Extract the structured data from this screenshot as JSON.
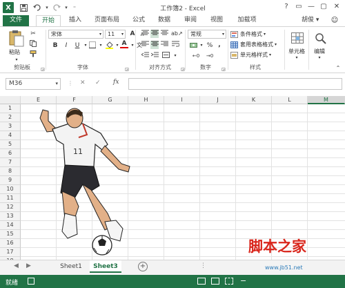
{
  "title": {
    "app_logo": "X",
    "window_title": "工作簿2 - Excel",
    "window_buttons": [
      "?",
      "▭",
      "—",
      "▢",
      "✕"
    ]
  },
  "tabs": {
    "items": [
      "文件",
      "开始",
      "插入",
      "页面布局",
      "公式",
      "数据",
      "审阅",
      "视图",
      "加载项"
    ],
    "active": "开始",
    "user": "胡俊 ▾"
  },
  "ribbon": {
    "clipboard": {
      "paste": "粘贴",
      "label": "剪贴板"
    },
    "font": {
      "name": "宋体",
      "size": "11",
      "bold": "B",
      "italic": "I",
      "underline": "U",
      "font_color": "A",
      "grow": "A",
      "shrink": "A",
      "label": "字体"
    },
    "alignment": {
      "label": "对齐方式"
    },
    "number": {
      "format": "常规",
      "percent": "%",
      "comma": ",",
      "label": "数字"
    },
    "styles": {
      "conditional": "条件格式",
      "table": "套用表格格式",
      "cell": "单元格样式",
      "label": "样式"
    },
    "cells": {
      "label": "单元格"
    },
    "editing": {
      "label": "编辑"
    }
  },
  "formula_bar": {
    "name_box": "M36",
    "cancel": "✕",
    "enter": "✓",
    "fx": "fx"
  },
  "grid": {
    "columns": [
      "E",
      "F",
      "G",
      "H",
      "I",
      "J",
      "K",
      "L",
      "M"
    ],
    "rows": [
      "1",
      "2",
      "3",
      "4",
      "5",
      "6",
      "7",
      "8",
      "9",
      "10",
      "11",
      "12",
      "13",
      "14",
      "15",
      "16",
      "17",
      "18"
    ]
  },
  "sheets": {
    "tabs": [
      "Sheet1",
      "Sheet3"
    ],
    "active": "Sheet3",
    "add": "+"
  },
  "status": {
    "mode": "就绪"
  },
  "watermark": {
    "main": "脚本之家",
    "url": "www.jb51.net"
  }
}
